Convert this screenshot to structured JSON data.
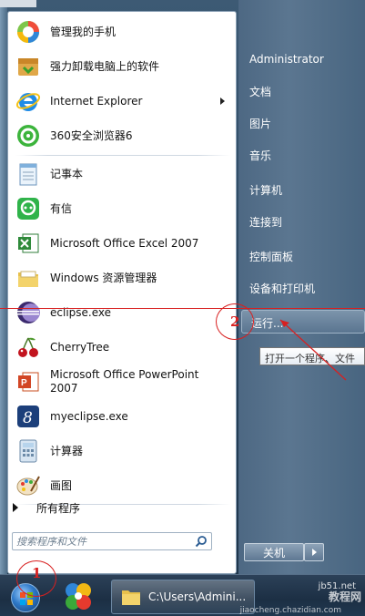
{
  "start_menu": {
    "programs": [
      {
        "label": "管理我的手机",
        "icon": "phone-manager-icon"
      },
      {
        "label": "强力卸载电脑上的软件",
        "icon": "uninstaller-icon"
      },
      {
        "label": "Internet Explorer",
        "icon": "ie-icon",
        "has_submenu": true
      },
      {
        "label": "360安全浏览器6",
        "icon": "360-browser-icon"
      },
      {
        "label": "记事本",
        "icon": "notepad-icon"
      },
      {
        "label": "有信",
        "icon": "youxin-icon"
      },
      {
        "label": "Microsoft Office Excel 2007",
        "icon": "excel-icon"
      },
      {
        "label": "Windows 资源管理器",
        "icon": "folder-icon"
      },
      {
        "label": "eclipse.exe",
        "icon": "eclipse-icon"
      },
      {
        "label": "CherryTree",
        "icon": "cherry-icon"
      },
      {
        "label": "Microsoft Office PowerPoint 2007",
        "icon": "powerpoint-icon"
      },
      {
        "label": "myeclipse.exe",
        "icon": "myeclipse-icon"
      },
      {
        "label": "计算器",
        "icon": "calculator-icon"
      },
      {
        "label": "画图",
        "icon": "paint-icon"
      }
    ],
    "all_programs_label": "所有程序",
    "search_placeholder": "搜索程序和文件",
    "right_items": [
      "Administrator",
      "文档",
      "图片",
      "音乐",
      "计算机",
      "连接到",
      "控制面板",
      "设备和打印机",
      "运行..."
    ],
    "tooltip": "打开一个程序、文件",
    "shutdown_label": "关机"
  },
  "taskbar": {
    "explorer_task_label": "C:\\Users\\Admini..."
  },
  "annotations": {
    "step1": "1",
    "step2": "2"
  },
  "watermark": {
    "line1": "jb51.net",
    "line2": "教程网",
    "line3": "jiaocheng.chazidian.com"
  },
  "colors": {
    "accent_red": "#d82020",
    "right_panel": "#5b7690"
  }
}
